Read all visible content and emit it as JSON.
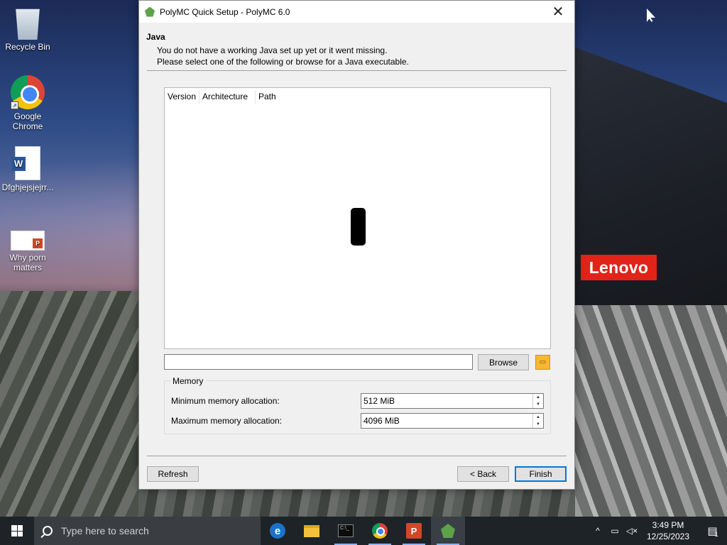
{
  "desktop": {
    "icons": [
      {
        "label": "Recycle Bin",
        "icon": "recycle-bin-icon"
      },
      {
        "label": "Google Chrome",
        "icon": "chrome-icon"
      },
      {
        "label": "Dfghjejsjejrr...",
        "icon": "word-document-icon"
      },
      {
        "label": "Why porn matters",
        "icon": "powerpoint-file-icon"
      }
    ],
    "wallpaper_brand": "Lenovo"
  },
  "window": {
    "title": "PolyMC Quick Setup - PolyMC 6.0",
    "section_title": "Java",
    "description_line1": "You do not have a working Java set up yet or it went missing.",
    "description_line2": "Please select one of the following or browse for a Java executable.",
    "columns": [
      "Version",
      "Architecture",
      "Path"
    ],
    "java_path_value": "",
    "browse_label": "Browse",
    "memory": {
      "legend": "Memory",
      "min_label": "Minimum memory allocation:",
      "min_value": "512 MiB",
      "max_label": "Maximum memory allocation:",
      "max_value": "4096 MiB"
    },
    "refresh_label": "Refresh",
    "back_label": "< Back",
    "finish_label": "Finish"
  },
  "taskbar": {
    "search_placeholder": "Type here to search",
    "apps": [
      "edge-icon",
      "file-explorer-icon",
      "terminal-icon",
      "chrome-icon",
      "powerpoint-icon",
      "polymc-icon"
    ],
    "time": "3:49 PM",
    "date": "12/25/2023",
    "notification_count": "1"
  },
  "colors": {
    "accent": "#0078d7",
    "taskbar": "#1e2328",
    "lenovo_red": "#e2231a"
  }
}
